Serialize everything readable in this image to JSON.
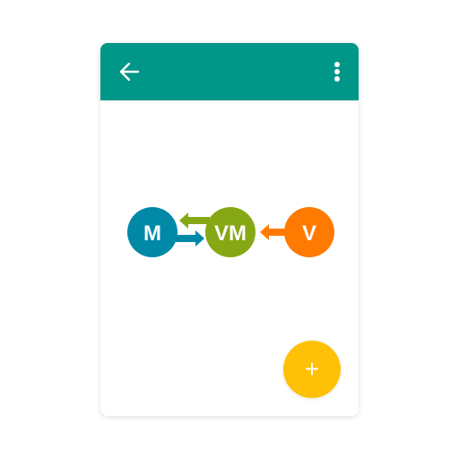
{
  "colors": {
    "appbar": "#009688",
    "model": "#0089A7",
    "viewmodel": "#86A815",
    "view": "#FF7A00",
    "fab": "#FFC107",
    "icon": "#ffffff"
  },
  "appbar": {
    "back_icon": "arrow-back-icon",
    "more_icon": "more-vert-icon"
  },
  "diagram": {
    "nodes": {
      "model": "M",
      "viewmodel": "VM",
      "view": "V"
    }
  },
  "fab": {
    "label": "+",
    "icon": "plus-icon"
  }
}
